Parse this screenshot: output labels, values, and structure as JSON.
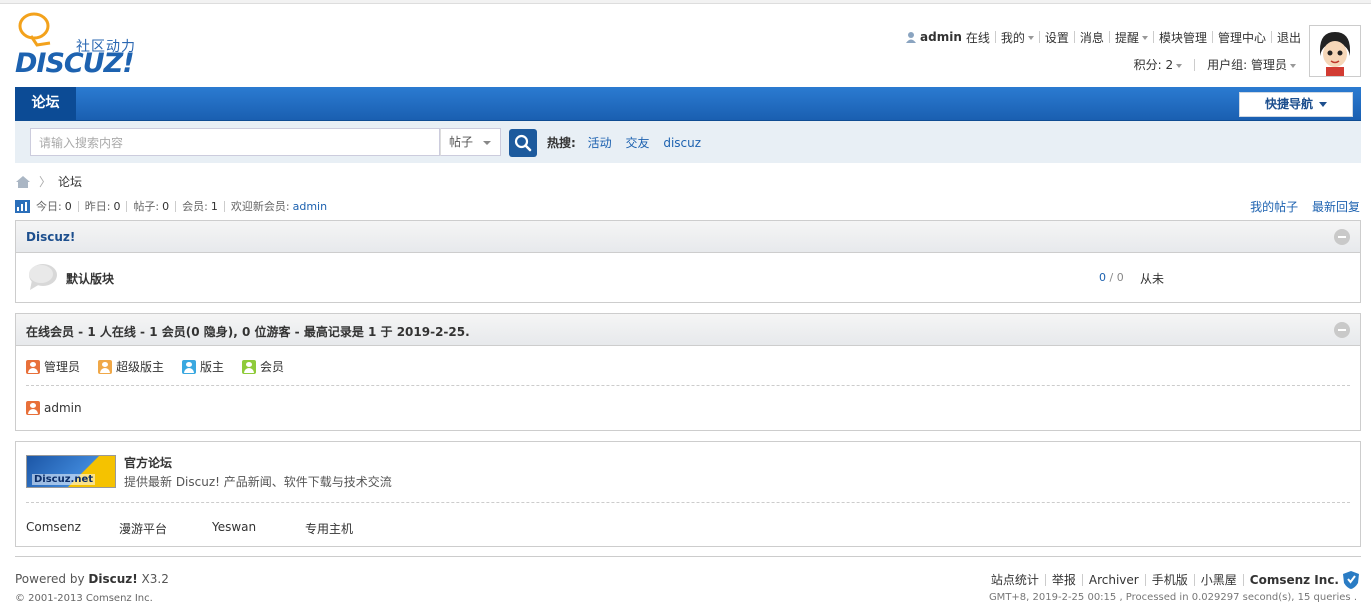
{
  "brand": {
    "logo_sub": "社区动力",
    "logo_main": "DISCUZ!"
  },
  "user_menu": {
    "username": "admin",
    "online": "在线",
    "my": "我的",
    "settings": "设置",
    "messages": "消息",
    "reminders": "提醒",
    "module_manage": "模块管理",
    "admin_center": "管理中心",
    "logout": "退出",
    "points": "积分: 2",
    "usergroup": "用户组: 管理员"
  },
  "nav": {
    "forum_tab": "论坛",
    "quick_nav": "快捷导航"
  },
  "search": {
    "placeholder": "请输入搜索内容",
    "type": "帖子",
    "hot_label": "热搜:",
    "hot_terms": [
      "活动",
      "交友",
      "discuz"
    ]
  },
  "breadcrumb": {
    "current": "论坛"
  },
  "stats": {
    "today_label": "今日:",
    "today": "0",
    "yesterday_label": "昨日:",
    "yesterday": "0",
    "posts_label": "帖子:",
    "posts": "0",
    "members_label": "会员:",
    "members": "1",
    "newest_label": "欢迎新会员:",
    "newest": "admin",
    "my_posts": "我的帖子",
    "latest_replies": "最新回复"
  },
  "category": {
    "title": "Discuz!",
    "forum": {
      "name": "默认版块",
      "threads": "0",
      "separator": "/",
      "posts": "0",
      "last_post": "从未"
    }
  },
  "online": {
    "title": "在线会员 - 1 人在线 - 1 会员(0 隐身), 0 位游客 - 最高记录是 1 于 2019-2-25.",
    "legend": [
      {
        "label": "管理员",
        "color": "#e8703a"
      },
      {
        "label": "超级版主",
        "color": "#f0a848"
      },
      {
        "label": "版主",
        "color": "#3aa8e0"
      },
      {
        "label": "会员",
        "color": "#8fcb3a"
      }
    ],
    "users": [
      {
        "name": "admin",
        "color": "#e8703a"
      }
    ]
  },
  "friend_links": {
    "featured_img_text": "Discuz.net",
    "featured_title": "官方论坛",
    "featured_desc": "提供最新 Discuz! 产品新闻、软件下载与技术交流",
    "links": [
      "Comsenz",
      "漫游平台",
      "Yeswan",
      "专用主机"
    ]
  },
  "footer": {
    "powered_prefix": "Powered by ",
    "powered_brand": "Discuz!",
    "version": " X3.2",
    "copyright": "© 2001-2013 Comsenz Inc.",
    "nav": [
      "站点统计",
      "举报",
      "Archiver",
      "手机版",
      "小黑屋"
    ],
    "company": "Comsenz Inc.",
    "info": "GMT+8, 2019-2-25 00:15 , Processed in 0.029297 second(s), 15 queries ."
  }
}
